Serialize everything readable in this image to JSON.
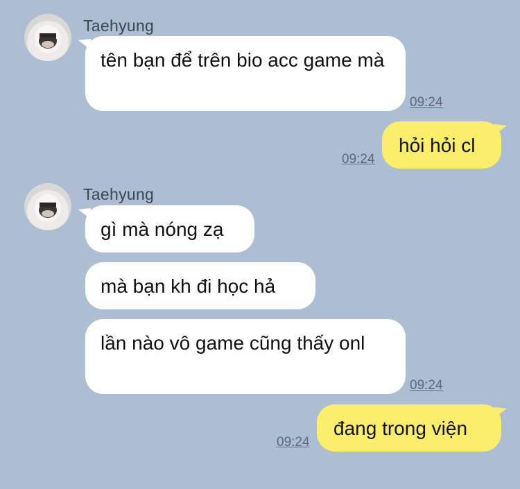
{
  "conversation": {
    "group1": {
      "sender": "Taehyung",
      "message1": {
        "text": "tên bạn để trên bio acc game mà",
        "time": "09:24"
      }
    },
    "reply1": {
      "text": "hỏi hỏi cl",
      "time": "09:24"
    },
    "group2": {
      "sender": "Taehyung",
      "message1": {
        "text": "gì mà nóng zạ"
      },
      "message2": {
        "text": "mà bạn kh đi học hả"
      },
      "message3": {
        "text": "lần nào vô game cũng thấy onl",
        "time": "09:24"
      }
    },
    "reply2": {
      "text": "đang trong viện",
      "time": "09:24"
    }
  },
  "colors": {
    "background": "#adbdd2",
    "incoming_bubble": "#ffffff",
    "outgoing_bubble": "#fbee6b"
  }
}
